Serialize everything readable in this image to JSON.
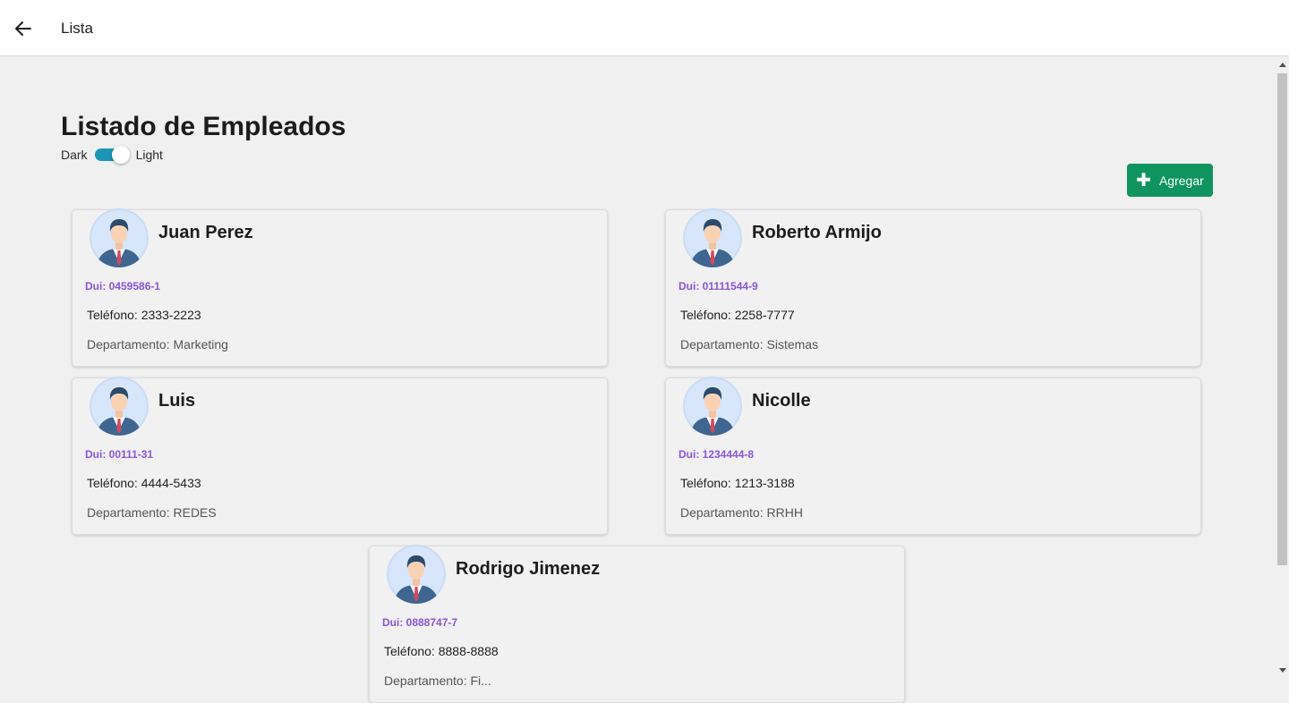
{
  "topbar": {
    "title": "Lista",
    "back_icon": "arrow-left-icon"
  },
  "page": {
    "title": "Listado de Empleados"
  },
  "theme_toggle": {
    "left_label": "Dark",
    "right_label": "Light",
    "state": "Light"
  },
  "add_button": {
    "label": "Agregar",
    "icon": "plus-icon",
    "color": "#0f9460"
  },
  "colors": {
    "dui": "#8a55d8",
    "toggle": "#1a95b6",
    "background": "#f0f0f0"
  },
  "employees": [
    {
      "name": "Juan Perez",
      "dui": "Dui: 0459586-1",
      "phone": "Teléfono: 2333-2223",
      "department": "Departamento: Marketing"
    },
    {
      "name": "Roberto Armijo",
      "dui": "Dui: 01111544-9",
      "phone": "Teléfono: 2258-7777",
      "department": "Departamento: Sistemas"
    },
    {
      "name": "Luis",
      "dui": "Dui: 00111-31",
      "phone": "Teléfono: 4444-5433",
      "department": "Departamento: REDES"
    },
    {
      "name": "Nicolle",
      "dui": "Dui: 1234444-8",
      "phone": "Teléfono: 1213-3188",
      "department": "Departamento: RRHH"
    },
    {
      "name": "Rodrigo Jimenez",
      "dui": "Dui: 0888747-7",
      "phone": "Teléfono: 8888-8888",
      "department": "Departamento: Fi..."
    }
  ]
}
